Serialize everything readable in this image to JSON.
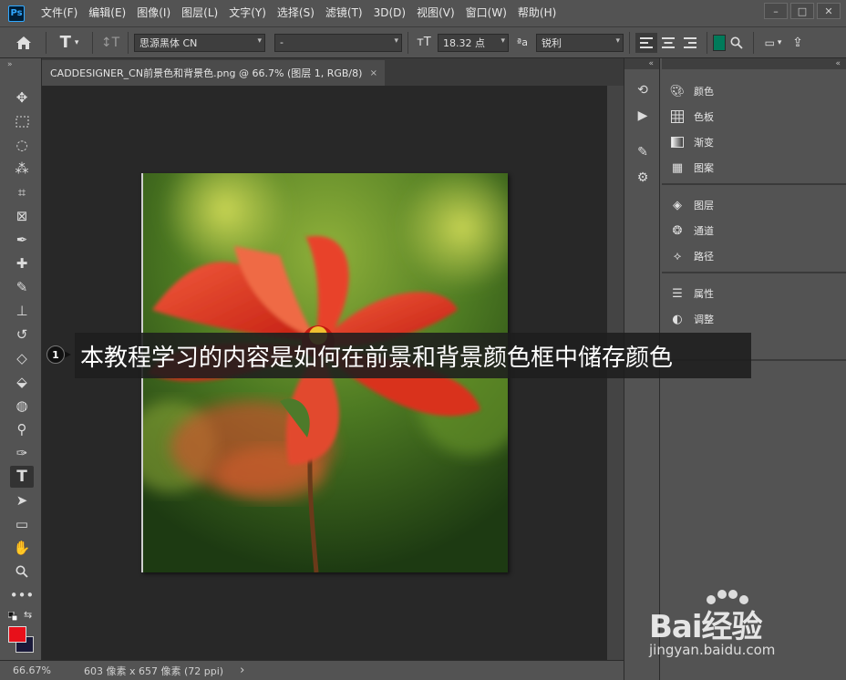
{
  "app": {
    "logo": "Ps"
  },
  "menu": [
    "文件(F)",
    "编辑(E)",
    "图像(I)",
    "图层(L)",
    "文字(Y)",
    "选择(S)",
    "滤镜(T)",
    "3D(D)",
    "视图(V)",
    "窗口(W)",
    "帮助(H)"
  ],
  "window_controls": {
    "minimize": "–",
    "maximize": "□",
    "close": "✕"
  },
  "options": {
    "font_family": "思源黑体 CN",
    "font_style": "-",
    "font_size": "18.32 点",
    "aa_label": "ªa",
    "antialias": "锐利",
    "text_color": "#007a5a"
  },
  "document": {
    "tab_title": "CADDESIGNER_CN前景色和背景色.png @ 66.7% (图层 1, RGB/8)",
    "tab_close": "×"
  },
  "status": {
    "zoom": "66.67%",
    "doc_info": "603 像素 x 657 像素 (72 ppi)",
    "arrow": "›"
  },
  "colors": {
    "foreground": "#e8101a",
    "background": "#1a1a3a"
  },
  "panels": {
    "group1": [
      {
        "label": "颜色",
        "icon": "palette-icon"
      },
      {
        "label": "色板",
        "icon": "swatches-icon"
      },
      {
        "label": "渐变",
        "icon": "gradient-icon"
      },
      {
        "label": "图案",
        "icon": "pattern-icon"
      }
    ],
    "group2": [
      {
        "label": "图层",
        "icon": "layers-icon"
      },
      {
        "label": "通道",
        "icon": "channels-icon"
      },
      {
        "label": "路径",
        "icon": "paths-icon"
      }
    ],
    "group3": [
      {
        "label": "属性",
        "icon": "properties-icon"
      },
      {
        "label": "调整",
        "icon": "adjustments-icon"
      }
    ]
  },
  "caption": {
    "step": "1",
    "text": "本教程学习的内容是如何在前景和背景颜色框中储存颜色"
  },
  "watermark": {
    "brand": "Bai经验",
    "url": "jingyan.baidu.com"
  }
}
